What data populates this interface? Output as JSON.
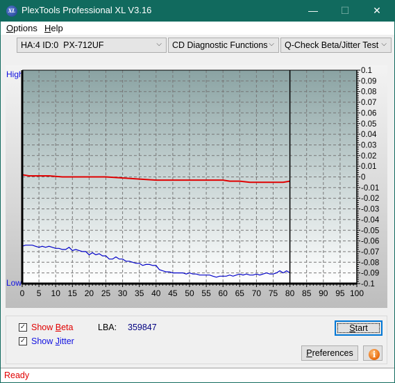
{
  "window": {
    "title": "PlexTools Professional XL V3.16",
    "icon": "xl-logo-icon",
    "icon_text": "XL",
    "controls": {
      "minimize": "—",
      "maximize": "☐",
      "close": "✕"
    }
  },
  "menu": [
    {
      "label": "Options",
      "mnemonic": "O",
      "rest": "ptions"
    },
    {
      "label": "Help",
      "mnemonic": "H",
      "rest": "elp"
    }
  ],
  "toolbar": {
    "drive_select": {
      "value": "HA:4 ID:0  PX-712UF"
    },
    "function_select": {
      "value": "CD Diagnostic Functions"
    },
    "test_select": {
      "value": "Q-Check Beta/Jitter Test"
    },
    "dropdown_glyph": "⌵"
  },
  "chart_labels": {
    "high": "High",
    "low": "Low"
  },
  "chart_data": {
    "type": "line",
    "title": "",
    "xlabel": "",
    "ylabel": "",
    "xlim": [
      0,
      100
    ],
    "ylim": [
      -0.1,
      0.1
    ],
    "x_ticks": [
      0,
      5,
      10,
      15,
      20,
      25,
      30,
      35,
      40,
      45,
      50,
      55,
      60,
      65,
      70,
      75,
      80,
      85,
      90,
      95,
      100
    ],
    "y_ticks": [
      "0.1",
      "0.09",
      "0.08",
      "0.07",
      "0.06",
      "0.05",
      "0.04",
      "0.03",
      "0.02",
      "0.01",
      "0",
      "-0.01",
      "-0.02",
      "-0.03",
      "-0.04",
      "-0.05",
      "-0.06",
      "-0.07",
      "-0.08",
      "-0.09",
      "-0.1"
    ],
    "y_tick_values": [
      0.1,
      0.09,
      0.08,
      0.07,
      0.06,
      0.05,
      0.04,
      0.03,
      0.02,
      0.01,
      0,
      -0.01,
      -0.02,
      -0.03,
      -0.04,
      -0.05,
      -0.06,
      -0.07,
      -0.08,
      -0.09,
      -0.1
    ],
    "grid": true,
    "end_marker_x": 80,
    "series": [
      {
        "name": "Beta",
        "color": "#e00000",
        "x": [
          0,
          2,
          5,
          8,
          10,
          12,
          15,
          18,
          20,
          25,
          30,
          35,
          40,
          45,
          50,
          55,
          60,
          62,
          65,
          68,
          70,
          72,
          75,
          78,
          80
        ],
        "y": [
          0.002,
          0.001,
          0.001,
          0.001,
          0.0005,
          0.0,
          0.0,
          0.0,
          0.0,
          0.0,
          -0.001,
          -0.002,
          -0.003,
          -0.003,
          -0.003,
          -0.003,
          -0.003,
          -0.004,
          -0.004,
          -0.005,
          -0.005,
          -0.005,
          -0.005,
          -0.005,
          -0.004
        ]
      },
      {
        "name": "Jitter",
        "color": "#0000c8",
        "x": [
          0,
          1,
          2,
          3,
          4,
          5,
          6,
          7,
          8,
          9,
          10,
          11,
          12,
          13,
          14,
          15,
          16,
          17,
          18,
          19,
          20,
          21,
          22,
          23,
          24,
          25,
          26,
          27,
          28,
          29,
          30,
          31,
          32,
          33,
          34,
          35,
          36,
          37,
          38,
          39,
          40,
          41,
          42,
          43,
          44,
          45,
          46,
          47,
          48,
          49,
          50,
          51,
          52,
          53,
          54,
          55,
          56,
          57,
          58,
          59,
          60,
          61,
          62,
          63,
          64,
          65,
          66,
          67,
          68,
          69,
          70,
          71,
          72,
          73,
          74,
          75,
          76,
          77,
          78,
          79,
          80
        ],
        "y": [
          -0.065,
          -0.064,
          -0.064,
          -0.064,
          -0.065,
          -0.066,
          -0.065,
          -0.066,
          -0.065,
          -0.066,
          -0.067,
          -0.067,
          -0.068,
          -0.068,
          -0.066,
          -0.069,
          -0.068,
          -0.069,
          -0.07,
          -0.07,
          -0.073,
          -0.071,
          -0.073,
          -0.072,
          -0.074,
          -0.074,
          -0.077,
          -0.077,
          -0.075,
          -0.077,
          -0.077,
          -0.079,
          -0.079,
          -0.08,
          -0.081,
          -0.081,
          -0.083,
          -0.082,
          -0.082,
          -0.083,
          -0.083,
          -0.087,
          -0.088,
          -0.089,
          -0.089,
          -0.09,
          -0.09,
          -0.09,
          -0.09,
          -0.091,
          -0.09,
          -0.091,
          -0.091,
          -0.092,
          -0.092,
          -0.092,
          -0.092,
          -0.093,
          -0.094,
          -0.093,
          -0.093,
          -0.093,
          -0.092,
          -0.093,
          -0.092,
          -0.091,
          -0.092,
          -0.091,
          -0.092,
          -0.092,
          -0.091,
          -0.092,
          -0.091,
          -0.09,
          -0.091,
          -0.091,
          -0.09,
          -0.088,
          -0.09,
          -0.088,
          -0.09
        ]
      }
    ]
  },
  "controls": {
    "show_beta": {
      "label_pre": "Show ",
      "mnemonic": "B",
      "label_post": "eta",
      "checked": true,
      "color": "#e00000"
    },
    "show_jitter": {
      "label_pre": "Show ",
      "mnemonic": "J",
      "label_post": "itter",
      "checked": true,
      "color": "#1010e0"
    },
    "lba_label": "LBA:",
    "lba_value": "359847",
    "start_button": {
      "mnemonic": "S",
      "rest": "tart"
    },
    "preferences_button": {
      "mnemonic": "P",
      "rest": "references"
    },
    "info_button": {
      "icon": "info-icon",
      "glyph": "i"
    },
    "checkmark_glyph": "✓"
  },
  "status": {
    "text": "Ready"
  }
}
